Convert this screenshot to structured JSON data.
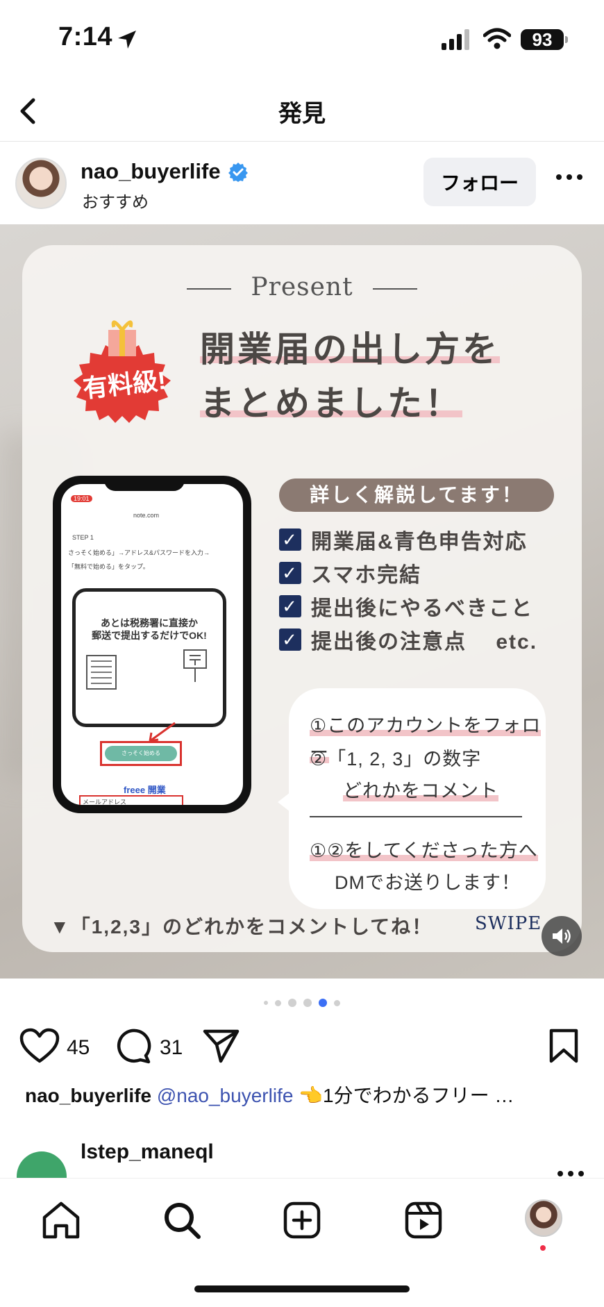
{
  "status_bar": {
    "time": "7:14",
    "battery": "93"
  },
  "nav": {
    "title": "発見"
  },
  "post": {
    "username": "nao_buyerlife",
    "subtitle": "おすすめ",
    "follow_label": "フォロー",
    "image": {
      "present": "Present",
      "badge": "有料級!",
      "headline_1": "開業届の出し方を",
      "headline_2": "まとめました！",
      "pill": "詳しく解説してます！",
      "checks": [
        "開業届&青色申告対応",
        "スマホ完結",
        "提出後にやるべきこと",
        "提出後の注意点　 etc."
      ],
      "phone": {
        "time": "19:01",
        "url": "note.com",
        "step": "STEP 1",
        "step_text_1": "さっそく始める」→アドレス&パスワードを入力→",
        "step_text_2": "「無料で始める」をタップ。",
        "inner_1": "あとは税務署に直接か",
        "inner_2": "郵送で提出するだけでOK!",
        "cta": "さっそく始める",
        "freee": "freee 開業",
        "field": "メールアドレス"
      },
      "bubble_1": "①このアカウントをフォロー",
      "bubble_2": "②「1, 2, 3」の数字",
      "bubble_3": "どれかをコメント",
      "bubble_4": "①②をしてくださった方へ",
      "bubble_5": "DMでお送りします！",
      "bottom": "▼「1,2,3」のどれかをコメントしてね！",
      "swipe": "SWIPE"
    },
    "likes": "45",
    "comments": "31",
    "caption_user": "nao_buyerlife",
    "caption_mention": "@nao_buyerlife",
    "caption_text": "👈1分でわかるフリー …"
  },
  "next_post": {
    "username": "lstep_maneql"
  },
  "colors": {
    "accent": "#3b6ff5",
    "verified": "#3897f0",
    "badge_red": "#e23b35",
    "navy": "#1d2f5e"
  }
}
